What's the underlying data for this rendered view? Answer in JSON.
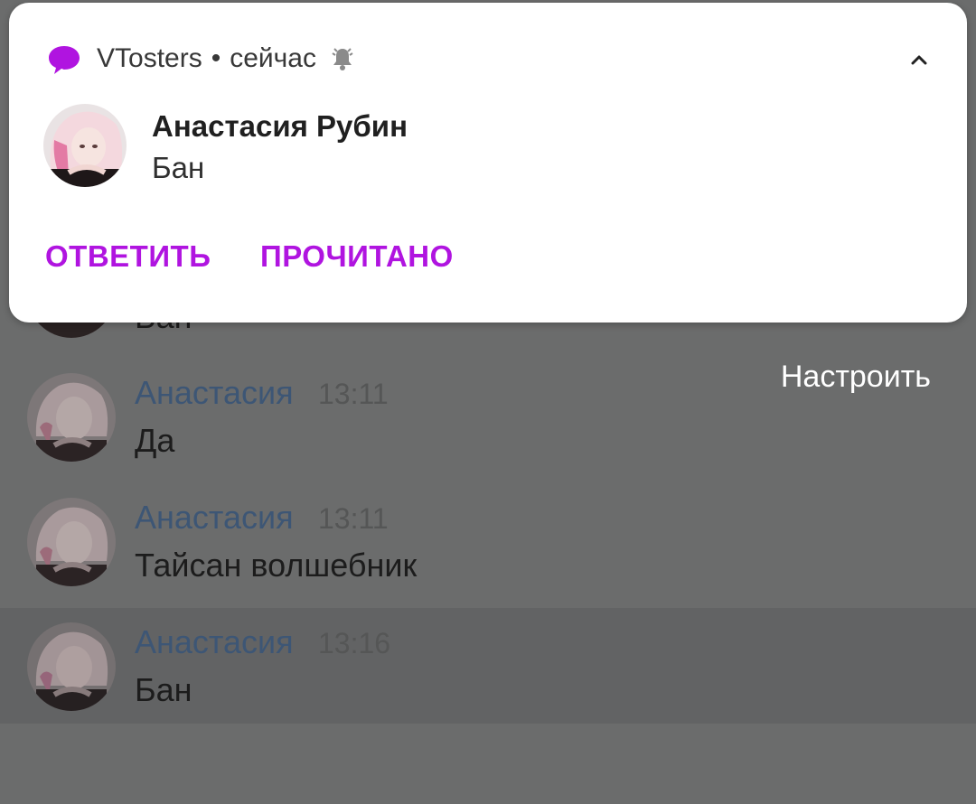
{
  "notification": {
    "app_name": "VTosters",
    "separator": "•",
    "time": "сейчас",
    "sender": "Анастасия Рубин",
    "text": "Бан",
    "actions": {
      "reply": "ОТВЕТИТЬ",
      "mark_read": "ПРОЧИТАНО"
    },
    "accent_color": "#b014e0",
    "icons": {
      "app": "chat-bubble-icon",
      "alert": "bell-icon",
      "collapse": "chevron-up-icon"
    }
  },
  "configure_label": "Настроить",
  "messages": [
    {
      "author": "",
      "time": "",
      "text": "Бан"
    },
    {
      "author": "Анастасия",
      "time": "13:11",
      "text": "Да"
    },
    {
      "author": "Анастасия",
      "time": "13:11",
      "text": "Тайсан волшебник"
    },
    {
      "author": "Анастасия",
      "time": "13:16",
      "text": "Бан"
    }
  ]
}
